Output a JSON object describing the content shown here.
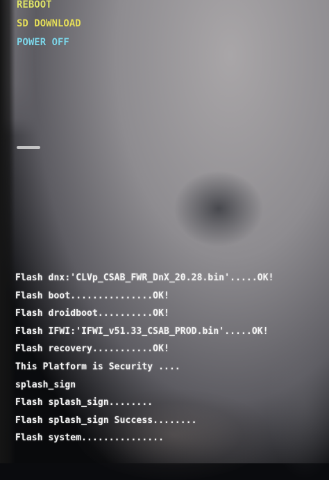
{
  "boot_menu": {
    "items": [
      {
        "label": "REBOOT",
        "color": "#dfe46a"
      },
      {
        "label": "SD DOWNLOAD",
        "color": "#e7df5c"
      },
      {
        "label": "POWER OFF",
        "color": "#7fd7ea"
      }
    ]
  },
  "flash_log": {
    "lines": [
      "Flash dnx:'CLVp_CSAB_FWR_DnX_20.28.bin'.....OK!",
      "Flash boot...............OK!",
      "Flash droidboot..........OK!",
      "Flash IFWI:'IFWI_v51.33_CSAB_PROD.bin'.....OK!",
      "Flash recovery...........OK!",
      "This Platform is Security ....",
      "splash_sign",
      "Flash splash_sign........",
      "Flash splash_sign Success........",
      "Flash system..............."
    ]
  }
}
